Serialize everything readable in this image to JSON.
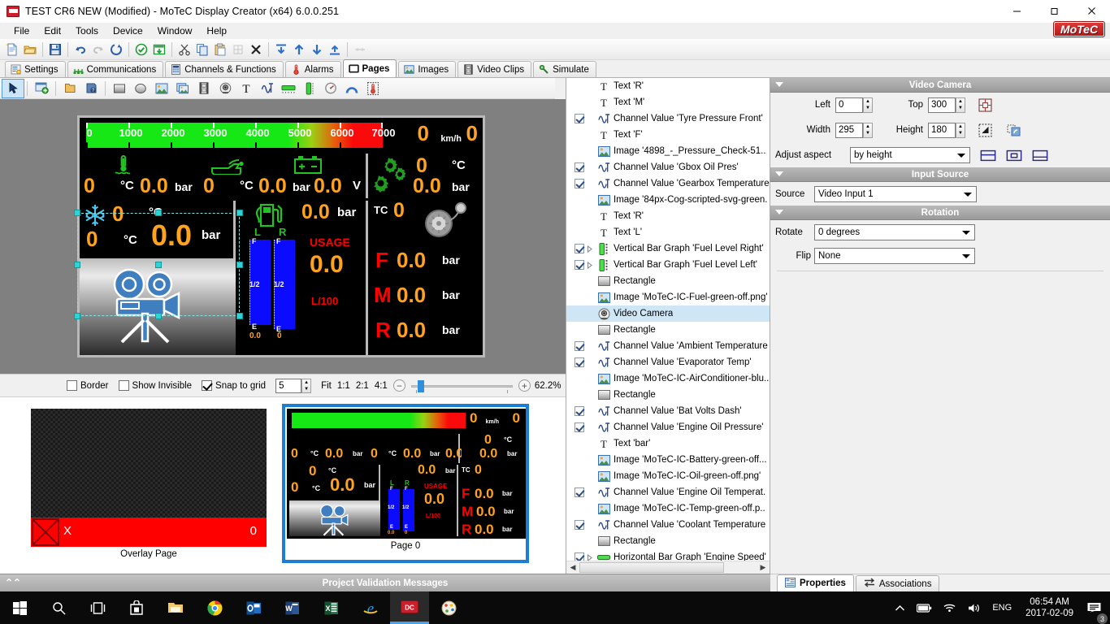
{
  "window": {
    "title": "TEST CR6  NEW (Modified) - MoTeC Display Creator (x64) 6.0.0.251",
    "app_icon": "motec-app-icon",
    "minimize": "minimize-icon",
    "maximize": "maximize-icon",
    "close": "close-icon",
    "brand": "MoTeC"
  },
  "menu": {
    "items": [
      "File",
      "Edit",
      "Tools",
      "Device",
      "Window",
      "Help"
    ]
  },
  "main_toolbar": {
    "groups": [
      [
        "new-document-icon",
        "open-folder-icon"
      ],
      [
        "save-icon"
      ],
      [
        "undo-icon",
        "redo-icon",
        "refresh-icon"
      ],
      [
        "check-circle-icon",
        "send-to-device-icon"
      ],
      [
        "cut-icon",
        "copy-icon",
        "paste-icon",
        "paste-special-icon",
        "delete-x-icon"
      ],
      [
        "send-to-back-icon",
        "move-up-icon",
        "move-down-icon",
        "bring-to-front-icon"
      ],
      [
        "align-icon"
      ]
    ]
  },
  "tabs": {
    "items": [
      {
        "label": "Settings",
        "icon": "settings-icon",
        "active": false
      },
      {
        "label": "Communications",
        "icon": "communications-icon",
        "active": false
      },
      {
        "label": "Channels & Functions",
        "icon": "channels-icon",
        "active": false
      },
      {
        "label": "Alarms",
        "icon": "alarms-icon",
        "active": false
      },
      {
        "label": "Pages",
        "icon": "pages-icon",
        "active": true
      },
      {
        "label": "Images",
        "icon": "images-icon",
        "active": false
      },
      {
        "label": "Video Clips",
        "icon": "video-clips-icon",
        "active": false
      },
      {
        "label": "Simulate",
        "icon": "simulate-icon",
        "active": false
      }
    ]
  },
  "editor_toolbar": {
    "tools": [
      "pointer-tool-icon",
      "new-page-icon",
      "open-page-icon",
      "page-properties-icon",
      "rectangle-tool-icon",
      "ellipse-tool-icon",
      "image-tool-icon",
      "image-sequence-tool-icon",
      "video-clip-tool-icon",
      "video-camera-tool-icon",
      "text-tool-icon",
      "channel-value-tool-icon",
      "horizontal-bar-tool-icon",
      "vertical-bar-tool-icon",
      "round-gauge-tool-icon",
      "arc-gauge-tool-icon",
      "thermometer-tool-icon"
    ],
    "selected": "pointer-tool-icon"
  },
  "dashboard": {
    "rpm_gauge": {
      "ticks": [
        "0",
        "1000",
        "2000",
        "3000",
        "4000",
        "5000",
        "6000",
        "7000"
      ],
      "min": 0,
      "max": 7000,
      "rpm_value": "0",
      "speed_value": "0",
      "speed_unit": "km/h"
    },
    "row2": {
      "coolant_temp_icon": "thermometer-water-icon",
      "coolant_temp": "0",
      "coolant_temp_unit": "°C",
      "coolant_pressure": "0.0",
      "coolant_pressure_unit": "bar",
      "oil_icon": "oil-can-icon",
      "oil_temp": "0",
      "oil_temp_unit": "°C",
      "oil_pressure": "0.0",
      "oil_pressure_unit": "bar",
      "battery_icon": "battery-icon",
      "battery_volts": "0.0",
      "battery_unit": "V",
      "gearbox_icon": "gears-icon",
      "gearbox_temp": "0",
      "gearbox_temp_unit": "°C",
      "gearbox_pressure": "0.0",
      "gearbox_pressure_unit": "bar"
    },
    "ac_panel": {
      "ac_icon": "snowflake-ac-icon",
      "ambient_temp": "0",
      "ambient_unit": "°C",
      "evaporator_temp": "0",
      "evaporator_unit": "°C",
      "ac_pressure": "0.0",
      "ac_pressure_unit": "bar"
    },
    "fuel_panel": {
      "fuel_icon": "fuel-pump-icon",
      "fuel_pressure": "0.0",
      "fuel_pressure_unit": "bar",
      "left_label": "L",
      "right_label": "R",
      "gauge_top": "F",
      "gauge_mid": "1/2",
      "gauge_bottom": "E",
      "left_value": "0.0",
      "right_value": "0",
      "usage_label": "USAGE",
      "usage_value": "0.0",
      "usage_unit": "L/100"
    },
    "tyre_panel": {
      "tc_label": "TC",
      "tc_value": "0",
      "tyre_icon": "tyre-pressure-icon",
      "rows": [
        {
          "label": "F",
          "value": "0.0",
          "unit": "bar"
        },
        {
          "label": "M",
          "value": "0.0",
          "unit": "bar"
        },
        {
          "label": "R",
          "value": "0.0",
          "unit": "bar"
        }
      ]
    },
    "selection": {
      "name": "video-camera-element"
    }
  },
  "canvas_bar": {
    "border": {
      "label": "Border",
      "checked": false
    },
    "show_invisible": {
      "label": "Show Invisible",
      "checked": false
    },
    "snap_to_grid": {
      "label": "Snap to grid",
      "checked": true
    },
    "grid_value": "5",
    "fit_label": "Fit",
    "zoom_presets": [
      "1:1",
      "2:1",
      "4:1"
    ],
    "zoom_out": "−",
    "zoom_in": "+",
    "zoom_level": "62.2%"
  },
  "pages": {
    "thumbs": [
      {
        "caption": "Overlay Page",
        "selected": false,
        "alarm_text": "X",
        "alarm_value": "0"
      },
      {
        "caption": "Page 0",
        "selected": true
      }
    ]
  },
  "tree": {
    "items": [
      {
        "checkbox": null,
        "expander": false,
        "icon": "text-icon",
        "label": "Text 'R'"
      },
      {
        "checkbox": null,
        "expander": false,
        "icon": "text-icon",
        "label": "Text 'M'"
      },
      {
        "checkbox": true,
        "expander": false,
        "icon": "channel-value-icon",
        "label": "Channel Value 'Tyre Pressure Front'"
      },
      {
        "checkbox": null,
        "expander": false,
        "icon": "text-icon",
        "label": "Text 'F'"
      },
      {
        "checkbox": null,
        "expander": false,
        "icon": "image-icon",
        "label": "Image '4898_-_Pressure_Check-51.."
      },
      {
        "checkbox": true,
        "expander": false,
        "icon": "channel-value-icon",
        "label": "Channel Value 'Gbox Oil Pres'"
      },
      {
        "checkbox": true,
        "expander": false,
        "icon": "channel-value-icon",
        "label": "Channel Value 'Gearbox Temperature"
      },
      {
        "checkbox": null,
        "expander": false,
        "icon": "image-icon",
        "label": "Image '84px-Cog-scripted-svg-green."
      },
      {
        "checkbox": null,
        "expander": false,
        "icon": "text-icon",
        "label": "Text 'R'"
      },
      {
        "checkbox": null,
        "expander": false,
        "icon": "text-icon",
        "label": "Text 'L'"
      },
      {
        "checkbox": true,
        "expander": true,
        "icon": "vertical-bar-icon",
        "label": "Vertical Bar Graph 'Fuel Level Right'"
      },
      {
        "checkbox": true,
        "expander": true,
        "icon": "vertical-bar-icon",
        "label": "Vertical Bar Graph 'Fuel Level Left'"
      },
      {
        "checkbox": null,
        "expander": false,
        "icon": "rectangle-icon",
        "label": "Rectangle"
      },
      {
        "checkbox": null,
        "expander": false,
        "icon": "image-icon",
        "label": "Image 'MoTeC-IC-Fuel-green-off.png'"
      },
      {
        "checkbox": null,
        "expander": false,
        "icon": "video-camera-icon",
        "label": "Video Camera",
        "selected": true
      },
      {
        "checkbox": null,
        "expander": false,
        "icon": "rectangle-icon",
        "label": "Rectangle"
      },
      {
        "checkbox": true,
        "expander": false,
        "icon": "channel-value-icon",
        "label": "Channel Value 'Ambient Temperature"
      },
      {
        "checkbox": true,
        "expander": false,
        "icon": "channel-value-icon",
        "label": "Channel Value 'Evaporator Temp'"
      },
      {
        "checkbox": null,
        "expander": false,
        "icon": "image-icon",
        "label": "Image 'MoTeC-IC-AirConditioner-blu.."
      },
      {
        "checkbox": null,
        "expander": false,
        "icon": "rectangle-icon",
        "label": "Rectangle"
      },
      {
        "checkbox": true,
        "expander": false,
        "icon": "channel-value-icon",
        "label": "Channel Value 'Bat Volts Dash'"
      },
      {
        "checkbox": true,
        "expander": false,
        "icon": "channel-value-icon",
        "label": "Channel Value 'Engine Oil Pressure'"
      },
      {
        "checkbox": null,
        "expander": false,
        "icon": "text-icon",
        "label": "Text 'bar'"
      },
      {
        "checkbox": null,
        "expander": false,
        "icon": "image-icon",
        "label": "Image 'MoTeC-IC-Battery-green-off..."
      },
      {
        "checkbox": null,
        "expander": false,
        "icon": "image-icon",
        "label": "Image 'MoTeC-IC-Oil-green-off.png'"
      },
      {
        "checkbox": true,
        "expander": false,
        "icon": "channel-value-icon",
        "label": "Channel Value 'Engine Oil Temperat."
      },
      {
        "checkbox": null,
        "expander": false,
        "icon": "image-icon",
        "label": "Image 'MoTeC-IC-Temp-green-off.p.."
      },
      {
        "checkbox": true,
        "expander": false,
        "icon": "channel-value-icon",
        "label": "Channel Value 'Coolant Temperature"
      },
      {
        "checkbox": null,
        "expander": false,
        "icon": "rectangle-icon",
        "label": "Rectangle"
      },
      {
        "checkbox": true,
        "expander": true,
        "icon": "horizontal-bar-icon",
        "label": "Horizontal Bar Graph 'Engine Speed'"
      }
    ]
  },
  "properties": {
    "groups": [
      {
        "title": "Video Camera",
        "fields": {
          "left_label": "Left",
          "left_value": "0",
          "top_label": "Top",
          "top_value": "300",
          "width_label": "Width",
          "width_value": "295",
          "height_label": "Height",
          "height_value": "180",
          "adjust_aspect_label": "Adjust aspect",
          "adjust_aspect_value": "by height"
        },
        "icons": [
          "center-object-icon",
          "resize-object-icon",
          "duplicate-object-icon",
          "align-top-icon",
          "align-center-icon",
          "align-bottom-icon"
        ]
      },
      {
        "title": "Input Source",
        "fields": {
          "source_label": "Source",
          "source_value": "Video Input 1"
        }
      },
      {
        "title": "Rotation",
        "fields": {
          "rotate_label": "Rotate",
          "rotate_value": "0 degrees",
          "flip_label": "Flip",
          "flip_value": "None"
        }
      }
    ]
  },
  "prop_tabs": [
    {
      "label": "Properties",
      "icon": "properties-icon",
      "active": true
    },
    {
      "label": "Associations",
      "icon": "associations-icon",
      "active": false
    }
  ],
  "status": {
    "validation": "Project Validation Messages"
  },
  "taskbar": {
    "buttons": [
      "windows-start-icon",
      "search-icon",
      "task-view-icon",
      "store-icon",
      "file-explorer-icon",
      "chrome-icon",
      "outlook-icon",
      "word-icon",
      "excel-icon",
      "internet-explorer-icon",
      "display-creator-icon",
      "paint-icon"
    ],
    "active_button": "display-creator-icon",
    "tray": {
      "chevron": "show-hidden-icons-icon",
      "battery": "battery-icon",
      "wifi": "wifi-icon",
      "volume": "volume-icon",
      "language": "ENG",
      "time": "06:54 AM",
      "date": "2017-02-09",
      "notifications_icon": "action-center-icon",
      "notifications_count": "3"
    }
  },
  "colors": {
    "accent_orange": "#FFA21E",
    "red": "#FF0000",
    "green": "#15E815",
    "blue_select": "#1A7FD4",
    "brand_red": "#C9202C"
  }
}
